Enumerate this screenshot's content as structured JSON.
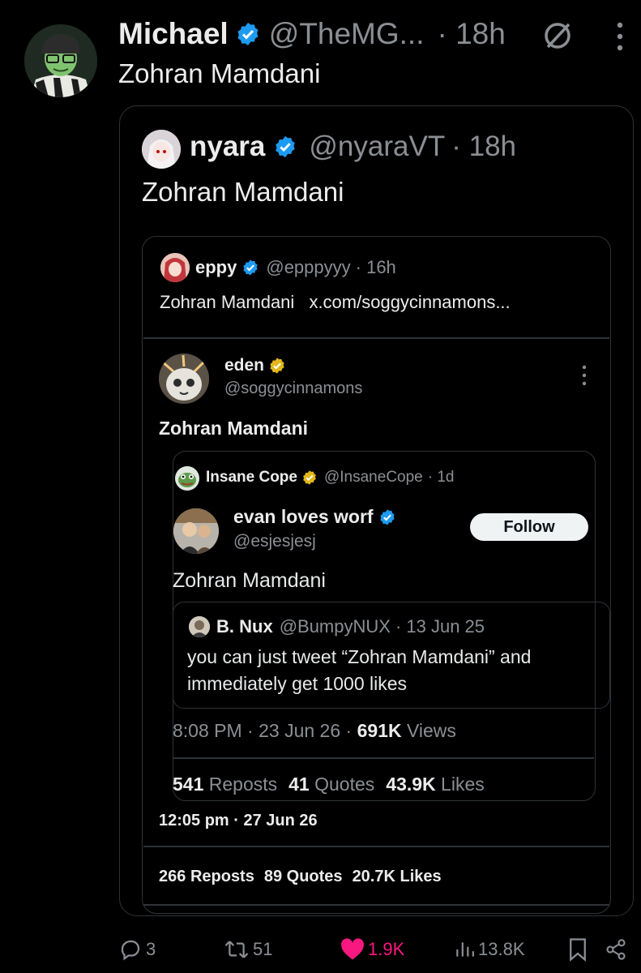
{
  "main_tweet": {
    "name": "Michael",
    "handle": "@TheMG...",
    "time": "· 18h",
    "text": "Zohran Mamdani"
  },
  "quote_nyara": {
    "name": "nyara",
    "handle": "@nyaraVT",
    "time": "· 18h",
    "text": "Zohran Mamdani"
  },
  "quote_eppy": {
    "name": "eppy",
    "handle": "@epppyyy",
    "time": "· 16h",
    "text": "Zohran Mamdani",
    "link": "x.com/soggycinnamons..."
  },
  "eden": {
    "name": "eden",
    "handle": "@soggycinnamons",
    "text": "Zohran Mamdani",
    "date": "12:05 pm · 27 Jun 26",
    "reposts_count": "266",
    "reposts_label": "Reposts",
    "quotes_count": "89",
    "quotes_label": "Quotes",
    "likes_count": "20.7K",
    "likes_label": "Likes"
  },
  "insane_cope": {
    "name": "Insane Cope",
    "handle": "@InsaneCope",
    "time": "· 1d"
  },
  "evan": {
    "name": "evan loves worf",
    "handle": "@esjesjesj",
    "follow_label": "Follow",
    "text": "Zohran Mamdani",
    "time": "8:08 PM · 23 Jun 26 · ",
    "views_count": "691K",
    "views_label": " Views",
    "reposts_count": "541",
    "reposts_label": " Reposts",
    "quotes_count": "41",
    "quotes_label": " Quotes",
    "likes_count": "43.9K",
    "likes_label": " Likes"
  },
  "nux": {
    "name": "B. Nux",
    "handle": "@BumpyNUX",
    "time": "· 13 Jun 25",
    "text": "you can just tweet “Zohran Mamdani” and immediately get 1000 likes"
  },
  "actions": {
    "replies": "3",
    "reposts": "51",
    "likes": "1.9K",
    "views": "13.8K"
  },
  "colors": {
    "verified_blue": "#1d9bf0",
    "verified_gold": "#e2b719",
    "like_pink": "#f91880",
    "border": "#2f3336"
  }
}
